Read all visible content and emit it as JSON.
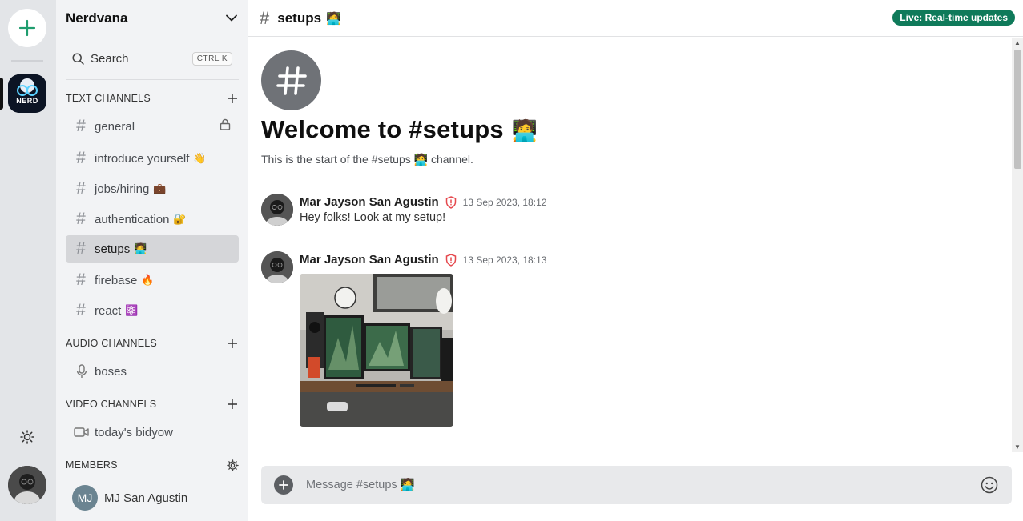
{
  "colors": {
    "accent": "#0f7a5a",
    "live_badge": "#0f7a5a",
    "active_channel": "#d5d6d9",
    "admin_shield": "#e5484d"
  },
  "rail": {
    "add_server_icon": "plus-icon",
    "server_logo_text": "NERD",
    "theme_icon": "sun-icon"
  },
  "server": {
    "name": "Nerdvana"
  },
  "search": {
    "label": "Search",
    "shortcut": "CTRL K"
  },
  "sections": {
    "text": "TEXT CHANNELS",
    "audio": "AUDIO CHANNELS",
    "video": "VIDEO CHANNELS",
    "members": "MEMBERS"
  },
  "text_channels": [
    {
      "name": "general",
      "emoji": "",
      "locked": true
    },
    {
      "name": "introduce yourself",
      "emoji": "👋"
    },
    {
      "name": "jobs/hiring",
      "emoji": "💼"
    },
    {
      "name": "authentication",
      "emoji": "🔐"
    },
    {
      "name": "setups",
      "emoji": "🧑‍💻",
      "active": true
    },
    {
      "name": "firebase",
      "emoji": "🔥"
    },
    {
      "name": "react",
      "emoji": "⚛️"
    }
  ],
  "audio_channels": [
    {
      "name": "boses"
    }
  ],
  "video_channels": [
    {
      "name": "today's bidyow"
    }
  ],
  "members": [
    {
      "initials": "MJ",
      "name": "MJ San Agustin"
    }
  ],
  "header": {
    "channel": "setups",
    "emoji": "🧑‍💻",
    "live_badge": "Live: Real-time updates"
  },
  "welcome": {
    "title": "Welcome to #setups",
    "emoji": "🧑‍💻",
    "subtitle": "This is the start of the #setups 🧑‍💻 channel."
  },
  "messages": [
    {
      "author": "Mar Jayson San Agustin",
      "time": "13 Sep 2023, 18:12",
      "text": "Hey folks! Look at my setup!"
    },
    {
      "author": "Mar Jayson San Agustin",
      "time": "13 Sep 2023, 18:13",
      "text": "",
      "has_image": true
    }
  ],
  "composer": {
    "placeholder": "Message #setups 🧑‍💻"
  }
}
